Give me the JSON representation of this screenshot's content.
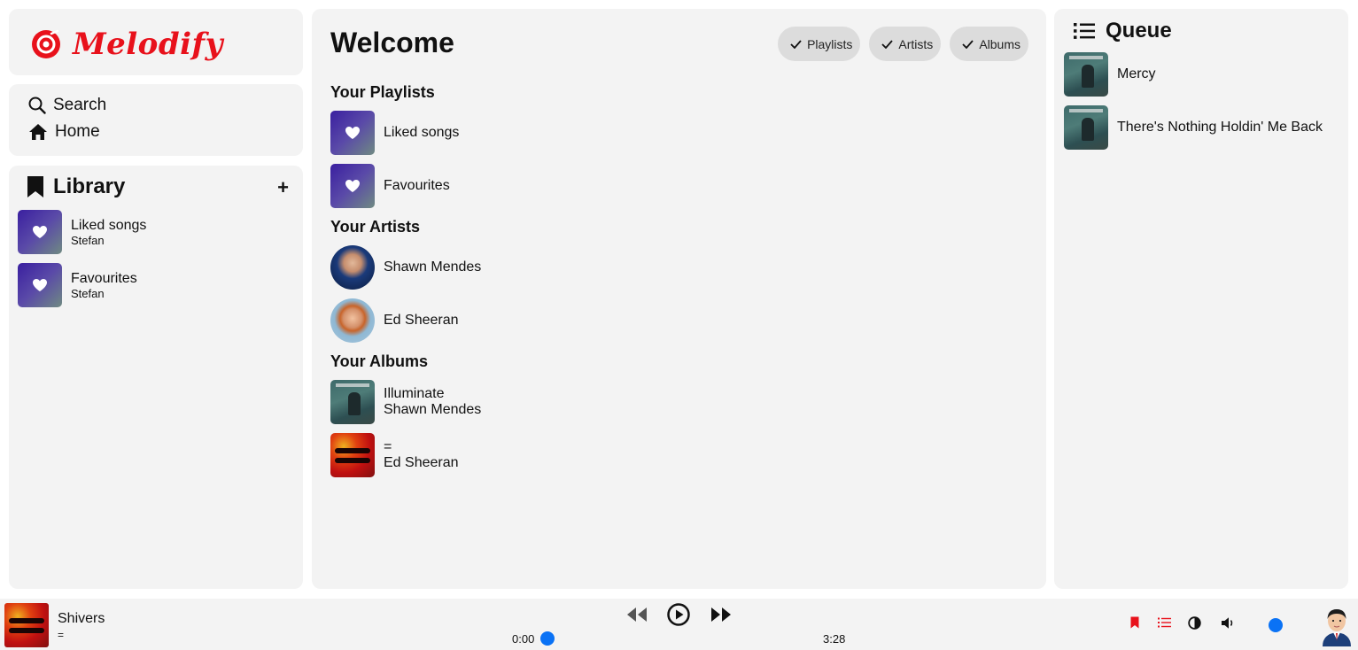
{
  "app": {
    "name": "Melodify",
    "brand_color": "#e8111b",
    "accent_color": "#0a72f5"
  },
  "nav": {
    "search_label": "Search",
    "home_label": "Home"
  },
  "library": {
    "title": "Library",
    "add_label": "+",
    "items": [
      {
        "title": "Liked songs",
        "owner": "Stefan"
      },
      {
        "title": "Favourites",
        "owner": "Stefan"
      }
    ]
  },
  "main": {
    "title": "Welcome",
    "filters": [
      {
        "label": "Playlists"
      },
      {
        "label": "Artists"
      },
      {
        "label": "Albums"
      }
    ],
    "playlists_heading": "Your Playlists",
    "playlists": [
      {
        "title": "Liked songs"
      },
      {
        "title": "Favourites"
      }
    ],
    "artists_heading": "Your Artists",
    "artists": [
      {
        "name": "Shawn Mendes"
      },
      {
        "name": "Ed Sheeran"
      }
    ],
    "albums_heading": "Your Albums",
    "albums": [
      {
        "title": "Illuminate",
        "artist": "Shawn Mendes"
      },
      {
        "title": "=",
        "artist": "Ed Sheeran"
      }
    ]
  },
  "queue": {
    "title": "Queue",
    "items": [
      {
        "title": "Mercy"
      },
      {
        "title": "There's Nothing Holdin' Me Back"
      }
    ]
  },
  "player": {
    "track_title": "Shivers",
    "track_album": "=",
    "current_time": "0:00",
    "duration": "3:28",
    "progress": 0,
    "volume": 1
  }
}
